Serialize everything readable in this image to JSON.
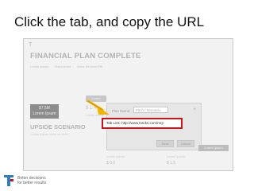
{
  "slide": {
    "title": "Click the tab, and copy the URL"
  },
  "screenshot": {
    "logo_mark": "T",
    "plan_title": "FINANCIAL PLAN COMPLETE",
    "links": [
      "Lorem Ipsum",
      "Dolor Amet",
      "Dolor Sit Amet Elit"
    ],
    "background_button": "Lorem",
    "card": {
      "line1": "$7.5M",
      "line2": "Lorem Ipsum"
    },
    "small_number": "$ 1.4",
    "small_label": "Lorem ipsum",
    "scenario_title": "UPSIDE SCENARIO",
    "scenario_sub": "Lorem ipsum dolor sit amet",
    "dialog": {
      "plan_name_label": "Plan Name:",
      "plan_name_value": "Pitch / Scenario",
      "close_glyph": "×",
      "link_text": "Tab Link:  http://www.tracks.com/mrp",
      "ok_label": "Save",
      "cancel_label": "Cancel"
    },
    "footer_button": "Lorem Ipsum",
    "footer_left_label": "Lorem ipsum",
    "footer_left_value": "$ 0.0",
    "footer_right_label": "Lorem ipsum",
    "footer_right_value": "$ 1.5"
  },
  "brand": {
    "tagline_line1": "Better decisions",
    "tagline_line2": "for better results",
    "colors": {
      "primary": "#2f7fbf",
      "accent": "#c8141b",
      "arrow": "#f2b400"
    }
  }
}
